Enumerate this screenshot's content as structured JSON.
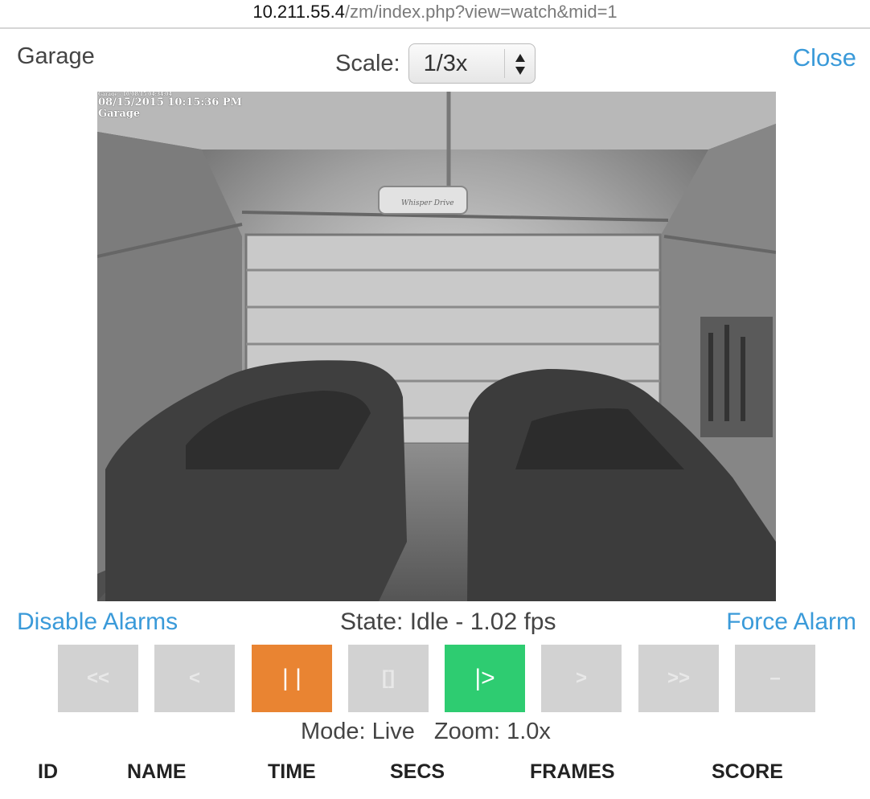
{
  "browser": {
    "url_host": "10.211.55.4",
    "url_path": "/zm/index.php?view=watch&mid=1"
  },
  "header": {
    "monitor_name": "Garage",
    "scale_label": "Scale:",
    "scale_value": "1/3x",
    "close_label": "Close"
  },
  "feed": {
    "overlay_line0": "Garage - 10/08/15 04:34:04",
    "overlay_line1": "08/15/2015 10:15:36 PM",
    "overlay_line2": "Garage",
    "opener_brand": "Whisper Drive"
  },
  "status": {
    "disable_alarms_label": "Disable Alarms",
    "state_text": "State: Idle - 1.02 fps",
    "force_alarm_label": "Force Alarm"
  },
  "controls": [
    {
      "label": "<<",
      "name": "fast-rewind-button"
    },
    {
      "label": "<",
      "name": "step-back-button"
    },
    {
      "label": "| |",
      "name": "pause-button"
    },
    {
      "label": "[]",
      "name": "stop-button"
    },
    {
      "label": "|>",
      "name": "play-button"
    },
    {
      "label": ">",
      "name": "step-forward-button"
    },
    {
      "label": ">>",
      "name": "fast-forward-button"
    },
    {
      "label": "–",
      "name": "zoom-out-button"
    }
  ],
  "mode": {
    "mode_text": "Mode: Live",
    "zoom_text": "Zoom: 1.0x"
  },
  "events_table": {
    "columns": [
      "ID",
      "NAME",
      "TIME",
      "SECS",
      "FRAMES",
      "SCORE"
    ]
  },
  "colors": {
    "link": "#3a9ad9",
    "pause_active": "#e98432",
    "play_active": "#2ecc71",
    "button_disabled": "#d2d2d2"
  }
}
